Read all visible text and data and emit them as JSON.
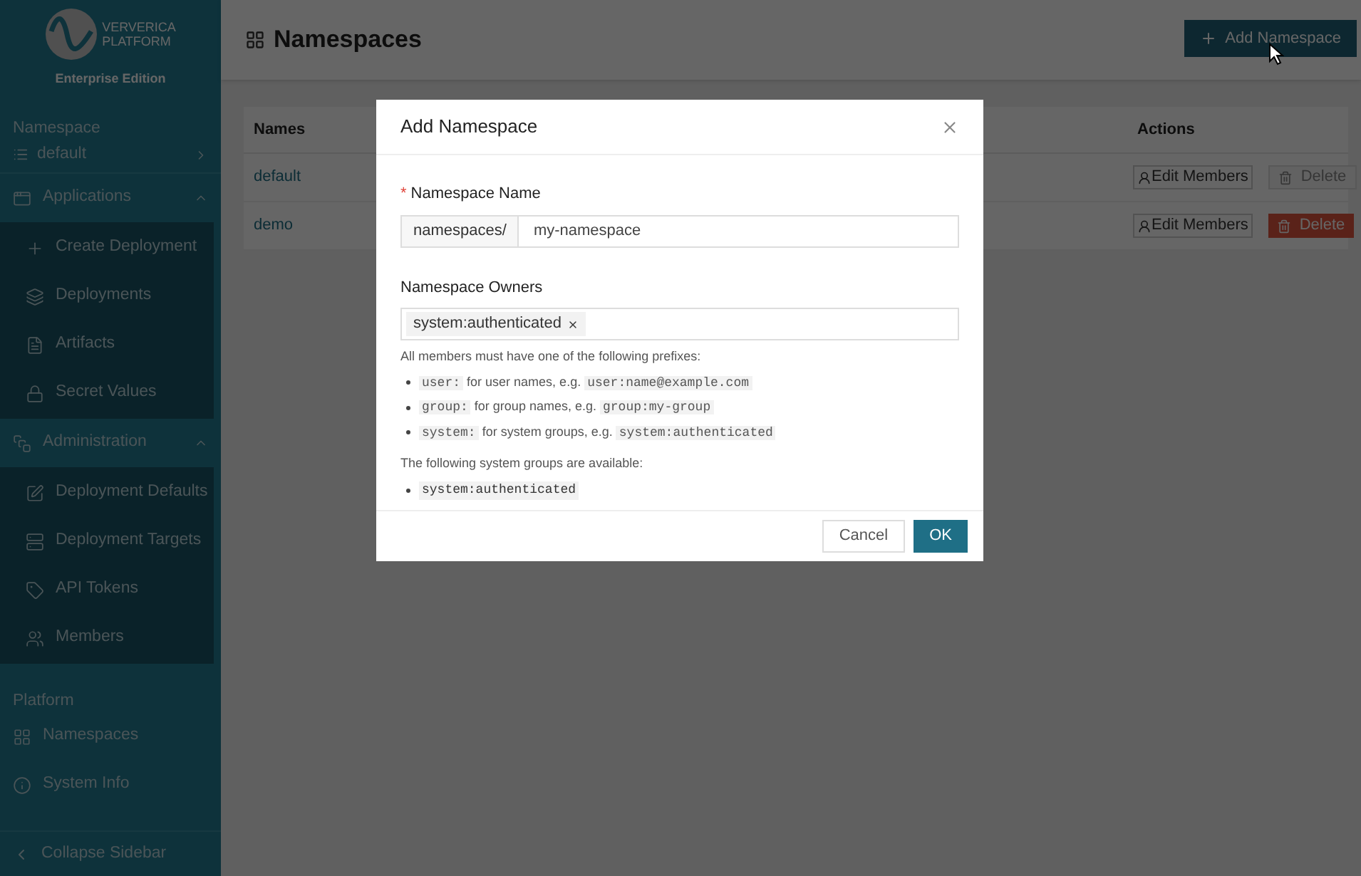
{
  "sidebar": {
    "logo": {
      "line_1": "VERVERICA",
      "line_2": "PLATFORM",
      "edition": "Enterprise Edition"
    },
    "namespace_label": "Namespace",
    "namespace_value": "default",
    "sections": [
      {
        "kind": "group",
        "label": "Applications",
        "expanded": true,
        "items": [
          {
            "label": "Create Deployment"
          },
          {
            "label": "Deployments"
          },
          {
            "label": "Artifacts"
          },
          {
            "label": "Secret Values"
          }
        ]
      },
      {
        "kind": "group",
        "label": "Administration",
        "expanded": true,
        "items": [
          {
            "label": "Deployment Defaults"
          },
          {
            "label": "Deployment Targets"
          },
          {
            "label": "API Tokens"
          },
          {
            "label": "Members"
          }
        ]
      }
    ],
    "platform_label": "Platform",
    "platform_items": [
      {
        "label": "Namespaces"
      },
      {
        "label": "System Info"
      }
    ],
    "collapse": "Collapse Sidebar"
  },
  "header": {
    "title": "Namespaces",
    "add_button": "Add Namespace"
  },
  "table": {
    "columns": [
      "Names",
      "Actions"
    ],
    "rows": [
      {
        "name": "default",
        "edit": "Edit Members",
        "delete": "Delete",
        "delete_disabled": true
      },
      {
        "name": "demo",
        "edit": "Edit Members",
        "delete": "Delete",
        "delete_disabled": false
      }
    ]
  },
  "dialog": {
    "title": "Add Namespace",
    "name_label": "Namespace Name",
    "required_mark": "*",
    "prefix": "namespaces/",
    "name_value": "my-namespace",
    "owners_label": "Namespace Owners",
    "owners": [
      "system:authenticated"
    ],
    "hint": "All members must have one of the following prefixes:",
    "prefixes": [
      {
        "prefix": "user:",
        "text": "for user names, e.g.",
        "example": "user:name@example.com"
      },
      {
        "prefix": "group:",
        "text": "for group names, e.g.",
        "example": "group:my-group"
      },
      {
        "prefix": "system:",
        "text": "for system groups, e.g.",
        "example": "system:authenticated"
      }
    ],
    "groups_hint": "The following system groups are available:",
    "groups": [
      "system:authenticated"
    ],
    "cancel": "Cancel",
    "ok": "OK"
  }
}
